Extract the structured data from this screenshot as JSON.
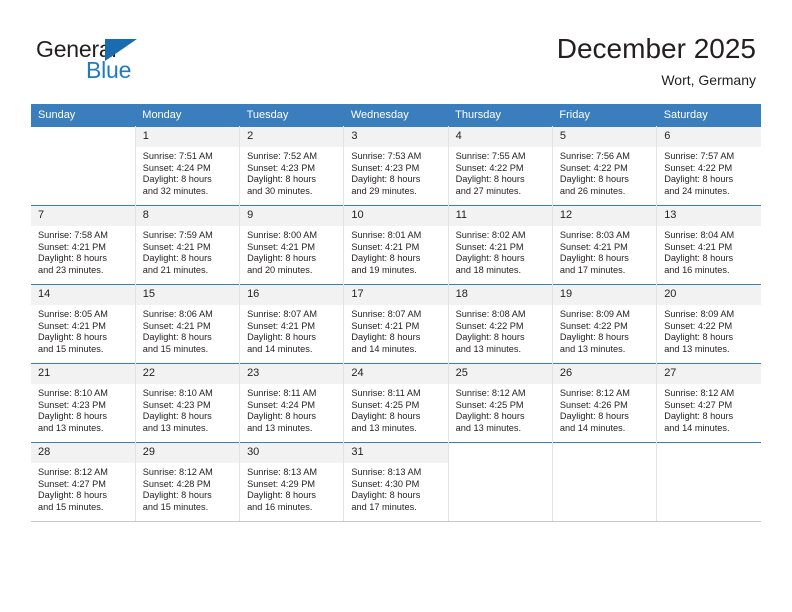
{
  "brand": {
    "name_part1": "General",
    "name_part2": "Blue",
    "logo_icon": "triangle-flag-icon"
  },
  "header": {
    "title": "December 2025",
    "subtitle": "Wort, Germany"
  },
  "calendar": {
    "weekday_headers": [
      "Sunday",
      "Monday",
      "Tuesday",
      "Wednesday",
      "Thursday",
      "Friday",
      "Saturday"
    ],
    "header_bg": "#3a7ebd",
    "daynum_bg": "#f2f2f2",
    "weeks": [
      [
        {
          "day": "",
          "sunrise": "",
          "sunset": "",
          "daylight1": "",
          "daylight2": ""
        },
        {
          "day": "1",
          "sunrise": "Sunrise: 7:51 AM",
          "sunset": "Sunset: 4:24 PM",
          "daylight1": "Daylight: 8 hours",
          "daylight2": "and 32 minutes."
        },
        {
          "day": "2",
          "sunrise": "Sunrise: 7:52 AM",
          "sunset": "Sunset: 4:23 PM",
          "daylight1": "Daylight: 8 hours",
          "daylight2": "and 30 minutes."
        },
        {
          "day": "3",
          "sunrise": "Sunrise: 7:53 AM",
          "sunset": "Sunset: 4:23 PM",
          "daylight1": "Daylight: 8 hours",
          "daylight2": "and 29 minutes."
        },
        {
          "day": "4",
          "sunrise": "Sunrise: 7:55 AM",
          "sunset": "Sunset: 4:22 PM",
          "daylight1": "Daylight: 8 hours",
          "daylight2": "and 27 minutes."
        },
        {
          "day": "5",
          "sunrise": "Sunrise: 7:56 AM",
          "sunset": "Sunset: 4:22 PM",
          "daylight1": "Daylight: 8 hours",
          "daylight2": "and 26 minutes."
        },
        {
          "day": "6",
          "sunrise": "Sunrise: 7:57 AM",
          "sunset": "Sunset: 4:22 PM",
          "daylight1": "Daylight: 8 hours",
          "daylight2": "and 24 minutes."
        }
      ],
      [
        {
          "day": "7",
          "sunrise": "Sunrise: 7:58 AM",
          "sunset": "Sunset: 4:21 PM",
          "daylight1": "Daylight: 8 hours",
          "daylight2": "and 23 minutes."
        },
        {
          "day": "8",
          "sunrise": "Sunrise: 7:59 AM",
          "sunset": "Sunset: 4:21 PM",
          "daylight1": "Daylight: 8 hours",
          "daylight2": "and 21 minutes."
        },
        {
          "day": "9",
          "sunrise": "Sunrise: 8:00 AM",
          "sunset": "Sunset: 4:21 PM",
          "daylight1": "Daylight: 8 hours",
          "daylight2": "and 20 minutes."
        },
        {
          "day": "10",
          "sunrise": "Sunrise: 8:01 AM",
          "sunset": "Sunset: 4:21 PM",
          "daylight1": "Daylight: 8 hours",
          "daylight2": "and 19 minutes."
        },
        {
          "day": "11",
          "sunrise": "Sunrise: 8:02 AM",
          "sunset": "Sunset: 4:21 PM",
          "daylight1": "Daylight: 8 hours",
          "daylight2": "and 18 minutes."
        },
        {
          "day": "12",
          "sunrise": "Sunrise: 8:03 AM",
          "sunset": "Sunset: 4:21 PM",
          "daylight1": "Daylight: 8 hours",
          "daylight2": "and 17 minutes."
        },
        {
          "day": "13",
          "sunrise": "Sunrise: 8:04 AM",
          "sunset": "Sunset: 4:21 PM",
          "daylight1": "Daylight: 8 hours",
          "daylight2": "and 16 minutes."
        }
      ],
      [
        {
          "day": "14",
          "sunrise": "Sunrise: 8:05 AM",
          "sunset": "Sunset: 4:21 PM",
          "daylight1": "Daylight: 8 hours",
          "daylight2": "and 15 minutes."
        },
        {
          "day": "15",
          "sunrise": "Sunrise: 8:06 AM",
          "sunset": "Sunset: 4:21 PM",
          "daylight1": "Daylight: 8 hours",
          "daylight2": "and 15 minutes."
        },
        {
          "day": "16",
          "sunrise": "Sunrise: 8:07 AM",
          "sunset": "Sunset: 4:21 PM",
          "daylight1": "Daylight: 8 hours",
          "daylight2": "and 14 minutes."
        },
        {
          "day": "17",
          "sunrise": "Sunrise: 8:07 AM",
          "sunset": "Sunset: 4:21 PM",
          "daylight1": "Daylight: 8 hours",
          "daylight2": "and 14 minutes."
        },
        {
          "day": "18",
          "sunrise": "Sunrise: 8:08 AM",
          "sunset": "Sunset: 4:22 PM",
          "daylight1": "Daylight: 8 hours",
          "daylight2": "and 13 minutes."
        },
        {
          "day": "19",
          "sunrise": "Sunrise: 8:09 AM",
          "sunset": "Sunset: 4:22 PM",
          "daylight1": "Daylight: 8 hours",
          "daylight2": "and 13 minutes."
        },
        {
          "day": "20",
          "sunrise": "Sunrise: 8:09 AM",
          "sunset": "Sunset: 4:22 PM",
          "daylight1": "Daylight: 8 hours",
          "daylight2": "and 13 minutes."
        }
      ],
      [
        {
          "day": "21",
          "sunrise": "Sunrise: 8:10 AM",
          "sunset": "Sunset: 4:23 PM",
          "daylight1": "Daylight: 8 hours",
          "daylight2": "and 13 minutes."
        },
        {
          "day": "22",
          "sunrise": "Sunrise: 8:10 AM",
          "sunset": "Sunset: 4:23 PM",
          "daylight1": "Daylight: 8 hours",
          "daylight2": "and 13 minutes."
        },
        {
          "day": "23",
          "sunrise": "Sunrise: 8:11 AM",
          "sunset": "Sunset: 4:24 PM",
          "daylight1": "Daylight: 8 hours",
          "daylight2": "and 13 minutes."
        },
        {
          "day": "24",
          "sunrise": "Sunrise: 8:11 AM",
          "sunset": "Sunset: 4:25 PM",
          "daylight1": "Daylight: 8 hours",
          "daylight2": "and 13 minutes."
        },
        {
          "day": "25",
          "sunrise": "Sunrise: 8:12 AM",
          "sunset": "Sunset: 4:25 PM",
          "daylight1": "Daylight: 8 hours",
          "daylight2": "and 13 minutes."
        },
        {
          "day": "26",
          "sunrise": "Sunrise: 8:12 AM",
          "sunset": "Sunset: 4:26 PM",
          "daylight1": "Daylight: 8 hours",
          "daylight2": "and 14 minutes."
        },
        {
          "day": "27",
          "sunrise": "Sunrise: 8:12 AM",
          "sunset": "Sunset: 4:27 PM",
          "daylight1": "Daylight: 8 hours",
          "daylight2": "and 14 minutes."
        }
      ],
      [
        {
          "day": "28",
          "sunrise": "Sunrise: 8:12 AM",
          "sunset": "Sunset: 4:27 PM",
          "daylight1": "Daylight: 8 hours",
          "daylight2": "and 15 minutes."
        },
        {
          "day": "29",
          "sunrise": "Sunrise: 8:12 AM",
          "sunset": "Sunset: 4:28 PM",
          "daylight1": "Daylight: 8 hours",
          "daylight2": "and 15 minutes."
        },
        {
          "day": "30",
          "sunrise": "Sunrise: 8:13 AM",
          "sunset": "Sunset: 4:29 PM",
          "daylight1": "Daylight: 8 hours",
          "daylight2": "and 16 minutes."
        },
        {
          "day": "31",
          "sunrise": "Sunrise: 8:13 AM",
          "sunset": "Sunset: 4:30 PM",
          "daylight1": "Daylight: 8 hours",
          "daylight2": "and 17 minutes."
        },
        {
          "day": "",
          "sunrise": "",
          "sunset": "",
          "daylight1": "",
          "daylight2": ""
        },
        {
          "day": "",
          "sunrise": "",
          "sunset": "",
          "daylight1": "",
          "daylight2": ""
        },
        {
          "day": "",
          "sunrise": "",
          "sunset": "",
          "daylight1": "",
          "daylight2": ""
        }
      ]
    ]
  }
}
